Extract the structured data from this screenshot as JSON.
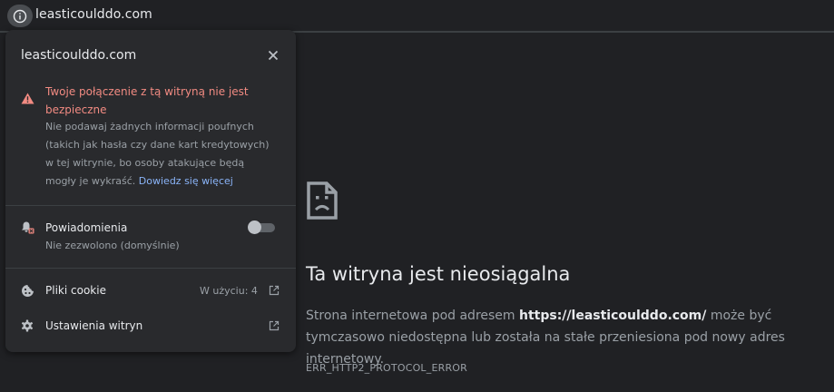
{
  "address_bar": {
    "url": "leasticoulddo.com",
    "site_info_icon": "info-icon"
  },
  "popup": {
    "host": "leasticoulddo.com",
    "close_icon": "close-icon",
    "warning": {
      "icon": "warning-triangle-icon",
      "title": "Twoje połączenie z tą witryną nie jest bezpieczne",
      "description": "Nie podawaj żadnych informacji poufnych (takich jak hasła czy dane kart kredytowych) w tej witrynie, bo osoby atakujące będą mogły je wykraść.",
      "link_label": "Dowiedz się więcej",
      "title_color": "#f28b82",
      "link_color": "#8ab4f8"
    },
    "notifications": {
      "icon": "notifications-blocked-icon",
      "label": "Powiadomienia",
      "status": "Nie zezwolono (domyślnie)",
      "enabled": false
    },
    "cookies": {
      "icon": "cookie-icon",
      "label": "Pliki cookie",
      "usage": "W użyciu: 4",
      "action_icon": "open-external-icon"
    },
    "site_settings": {
      "icon": "gear-icon",
      "label": "Ustawienia witryn",
      "action_icon": "open-external-icon"
    }
  },
  "error_page": {
    "icon": "sad-page-icon",
    "title": "Ta witryna jest nieosiągalna",
    "message_prefix": "Strona internetowa pod adresem ",
    "message_url": "https://leasticoulddo.com/",
    "message_suffix": " może być tymczasowo niedostępna lub została na stałe przeniesiona pod nowy adres internetowy.",
    "error_code": "ERR_HTTP2_PROTOCOL_ERROR"
  }
}
